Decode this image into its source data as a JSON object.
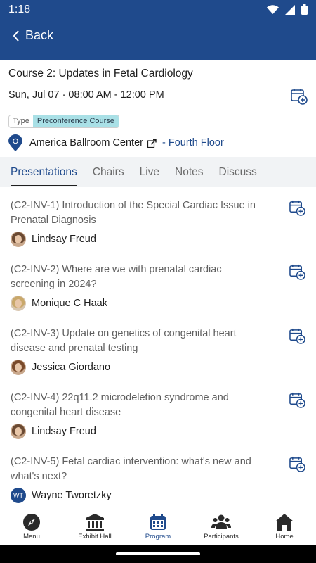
{
  "status": {
    "time": "1:18"
  },
  "header": {
    "back_label": "Back"
  },
  "course": {
    "title": "Course 2: Updates in Fetal Cardiology",
    "datetime": "Sun, Jul 07 · 08:00 AM - 12:00 PM",
    "type_key": "Type",
    "type_value": "Preconference Course",
    "location": "America Ballroom Center",
    "floor": "- Fourth Floor"
  },
  "tabs": [
    {
      "label": "Presentations"
    },
    {
      "label": "Chairs"
    },
    {
      "label": "Live"
    },
    {
      "label": "Notes"
    },
    {
      "label": "Discuss"
    }
  ],
  "presentations": [
    {
      "title": "(C2-INV-1) Introduction of the Special Cardiac Issue in Prenatal Diagnosis",
      "speaker": "Lindsay Freud"
    },
    {
      "title": "(C2-INV-2) Where are we with prenatal cardiac screening in 2024?",
      "speaker": "Monique C Haak"
    },
    {
      "title": "(C2-INV-3) Update on genetics of congenital heart disease and prenatal testing",
      "speaker": "Jessica Giordano"
    },
    {
      "title": "(C2-INV-4) 22q11.2 microdeletion syndrome and congenital heart disease",
      "speaker": "Lindsay Freud"
    },
    {
      "title": "(C2-INV-5) Fetal cardiac intervention: what's new and what's next?",
      "speaker": "Wayne Tworetzky",
      "initials": "WT"
    }
  ],
  "nav": [
    {
      "label": "Menu"
    },
    {
      "label": "Exhibit Hall"
    },
    {
      "label": "Program"
    },
    {
      "label": "Participants"
    },
    {
      "label": "Home"
    }
  ],
  "colors": {
    "brand": "#1f4a8c",
    "badge": "#a9e0e6"
  }
}
